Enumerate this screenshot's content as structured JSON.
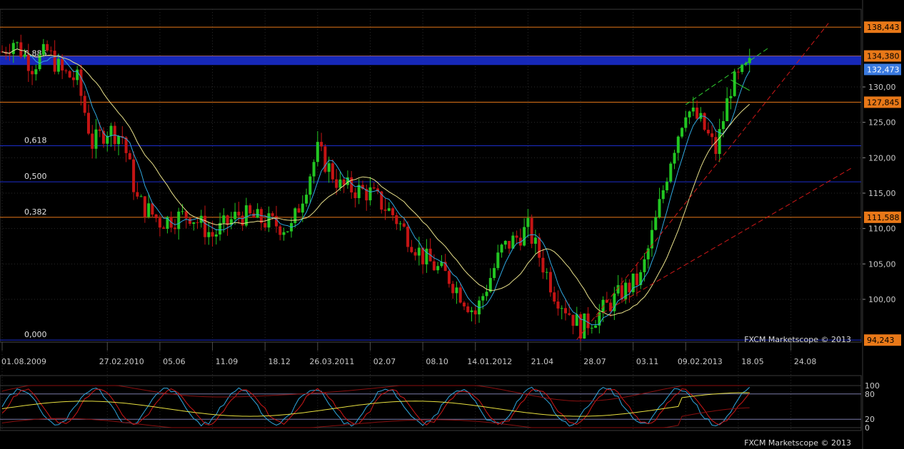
{
  "chart_data": {
    "type": "candlestick",
    "watermark": "FXCM Marketscope © 2013",
    "price_axis": {
      "ylim": [
        93.5,
        140.5
      ],
      "tick_labels": [
        "130,00",
        "125,00",
        "120,00",
        "115,00",
        "110,00",
        "105,00",
        "100,00"
      ],
      "tick_values": [
        130,
        125,
        120,
        115,
        110,
        105,
        100
      ],
      "price_tags": [
        {
          "label": "138,443",
          "value": 138.443,
          "color": "#e87818"
        },
        {
          "label": "134,380",
          "value": 134.38,
          "color": "#e87818"
        },
        {
          "label": "132,473",
          "value": 132.473,
          "color": "#3a7ae0"
        },
        {
          "label": "127,845",
          "value": 127.845,
          "color": "#e87818"
        },
        {
          "label": "111,588",
          "value": 111.588,
          "color": "#e87818"
        },
        {
          "label": "94,243",
          "value": 94.243,
          "color": "#e87818"
        }
      ]
    },
    "time_axis": {
      "tick_labels": [
        "01.08.2009",
        "27.02.2010",
        "05.06",
        "11.09",
        "18.12",
        "26.03.2011",
        "02.07",
        "08.10",
        "14.01.2012",
        "21.04",
        "28.07",
        "03.11",
        "09.02.2013",
        "18.05",
        "24.08"
      ],
      "tick_index": [
        0,
        28,
        42,
        56,
        70,
        84,
        98,
        112,
        126,
        140,
        154,
        168,
        182,
        196,
        210
      ]
    },
    "fibonacci_levels": [
      {
        "label": "0,886",
        "value": 134.0
      },
      {
        "label": "0,618",
        "value": 121.7
      },
      {
        "label": "0,500",
        "value": 116.6
      },
      {
        "label": "0,382",
        "value": 111.588
      },
      {
        "label": "0,000",
        "value": 94.243
      }
    ],
    "horizontal_lines": [
      {
        "value": 138.443,
        "color": "#e87818"
      },
      {
        "value": 134.38,
        "color": "#e87818"
      },
      {
        "value": 127.845,
        "color": "#e87818"
      },
      {
        "value": 121.7,
        "color": "#1c2ecc"
      },
      {
        "value": 116.6,
        "color": "#1c2ecc"
      },
      {
        "value": 111.588,
        "color": "#e87818"
      },
      {
        "value": 94.243,
        "color": "#1c2ecc"
      }
    ],
    "resistance_band": [
      133.1,
      134.38
    ],
    "anchors": [
      [
        0,
        135
      ],
      [
        3,
        136.5
      ],
      [
        8,
        133
      ],
      [
        12,
        135
      ],
      [
        16,
        132
      ],
      [
        20,
        131
      ],
      [
        24,
        122
      ],
      [
        28,
        124
      ],
      [
        32,
        123
      ],
      [
        36,
        114
      ],
      [
        42,
        111
      ],
      [
        50,
        112
      ],
      [
        56,
        109
      ],
      [
        63,
        112
      ],
      [
        70,
        111
      ],
      [
        77,
        110
      ],
      [
        84,
        121
      ],
      [
        90,
        116
      ],
      [
        98,
        115
      ],
      [
        104,
        112
      ],
      [
        112,
        106
      ],
      [
        119,
        103
      ],
      [
        126,
        98
      ],
      [
        133,
        107
      ],
      [
        140,
        110
      ],
      [
        147,
        101
      ],
      [
        154,
        96
      ],
      [
        159,
        98
      ],
      [
        165,
        101
      ],
      [
        170,
        103
      ],
      [
        174,
        111
      ],
      [
        178,
        120
      ],
      [
        182,
        127
      ],
      [
        186,
        125
      ],
      [
        190,
        121
      ],
      [
        194,
        130
      ],
      [
        199,
        133
      ]
    ],
    "trend_lines": [
      {
        "from": [
          153,
          94.3
        ],
        "to": [
          220,
          139
        ],
        "style": "dashed",
        "color": "#d01818"
      },
      {
        "from": [
          158,
          97.5
        ],
        "to": [
          226,
          118.5
        ],
        "style": "dashed",
        "color": "#d01818"
      },
      {
        "from": [
          182,
          127.5
        ],
        "to": [
          204,
          135.5
        ],
        "style": "dashed",
        "color": "#30d030"
      },
      {
        "from": [
          194,
          131
        ],
        "to": [
          199,
          129.5
        ],
        "style": "solid",
        "color": "#30d030"
      }
    ],
    "oscillator": {
      "ylim": [
        0,
        100
      ],
      "tick_labels": [
        "100",
        "80",
        "20",
        "0"
      ],
      "tick_values": [
        100,
        80,
        20,
        0
      ],
      "series_colors": [
        "#30a8e0",
        "#d01818",
        "#e8e040"
      ]
    },
    "colors": {
      "up": "#22c622",
      "down": "#c41414",
      "ma_fast": "#30a8e0",
      "ma_slow": "#e8e08a"
    }
  }
}
